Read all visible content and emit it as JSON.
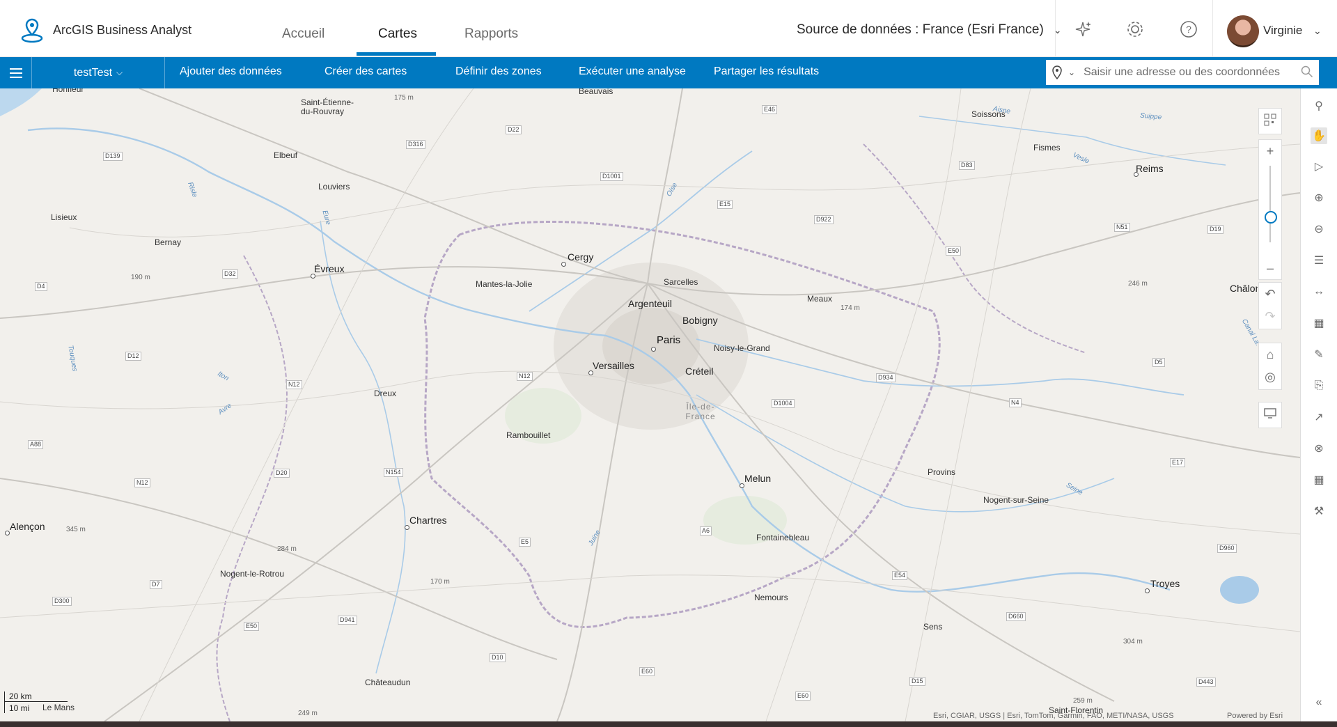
{
  "app": {
    "name": "ArcGIS Business Analyst",
    "tabs": [
      {
        "label": "Accueil"
      },
      {
        "label": "Cartes",
        "active": true
      },
      {
        "label": "Rapports"
      }
    ],
    "data_source": "Source de données : France (Esri France)",
    "user": "Virginie",
    "accent_color": "#0079c1"
  },
  "toolbar": {
    "project": "testTest",
    "menu": [
      "Ajouter des données",
      "Créer des cartes",
      "Définir des zones",
      "Exécuter une analyse",
      "Partager les résultats"
    ],
    "search_placeholder": "Saisir une adresse ou des coordonnées"
  },
  "map": {
    "cities_major": [
      "Paris",
      "Versailles",
      "Argenteuil",
      "Bobigny",
      "Créteil",
      "Cergy",
      "Évreux",
      "Chartres",
      "Melun",
      "Reims",
      "Troyes",
      "Alençon"
    ],
    "cities": [
      "Honfleur",
      "Saint-Étienne-du-Rouvray",
      "Beauvais",
      "Soissons",
      "Fismes",
      "Elbeuf",
      "Louviers",
      "Lisieux",
      "Bernay",
      "Mantes-la-Jolie",
      "Sarcelles",
      "Meaux",
      "Noisy-le-Grand",
      "Dreux",
      "Rambouillet",
      "Provins",
      "Nogent-sur-Seine",
      "Fontainebleau",
      "Nemours",
      "Sens",
      "Nogent-le-Rotrou",
      "Châteaudun",
      "Le Mans",
      "Saint-Florentin",
      "Châlons-en-Champagne"
    ],
    "region": "Île-de-France",
    "elevations": [
      "175 m",
      "190 m",
      "174 m",
      "246 m",
      "345 m",
      "284 m",
      "170 m",
      "304 m",
      "259 m",
      "249 m"
    ],
    "water": [
      "Risle",
      "Eure",
      "Oise",
      "Aisne",
      "Vesle",
      "Suippe",
      "Touques",
      "Iton",
      "Avre",
      "Seine",
      "Juine",
      "Canal La."
    ],
    "roads": [
      "D22",
      "D316",
      "D139",
      "D1001",
      "E46",
      "E15",
      "D922",
      "D83",
      "N51",
      "D19",
      "E50",
      "D32",
      "D4",
      "D12",
      "N12",
      "D934",
      "D1004",
      "N4",
      "D5",
      "A88",
      "D20",
      "N154",
      "E17",
      "E5",
      "A6",
      "D960",
      "D7",
      "E54",
      "D300",
      "D941",
      "E50",
      "D660",
      "D10",
      "E60",
      "D15",
      "D443",
      "E60"
    ],
    "scale_km": "20 km",
    "scale_mi": "10 mi",
    "attribution": "Esri, CGIAR, USGS | Esri, TomTom, Garmin, FAO, METI/NASA, USGS",
    "powered_by": "Powered by Esri"
  },
  "icons": {
    "header": [
      "sparkle-icon",
      "gear-icon",
      "help-icon"
    ],
    "map_controls": [
      "qr-icon",
      "zoom-in-icon",
      "zoom-out-icon",
      "undo-icon",
      "redo-icon",
      "home-icon",
      "locate-icon",
      "screen-icon"
    ],
    "right_panel": [
      "pin-icon",
      "pan-icon",
      "select-icon",
      "zoom-in-icon",
      "zoom-out-icon",
      "list-icon",
      "measure-icon",
      "legend-icon",
      "edit-icon",
      "report-icon",
      "share-icon",
      "close-circle-icon",
      "grid-icon",
      "tools-icon",
      "collapse-icon"
    ]
  }
}
